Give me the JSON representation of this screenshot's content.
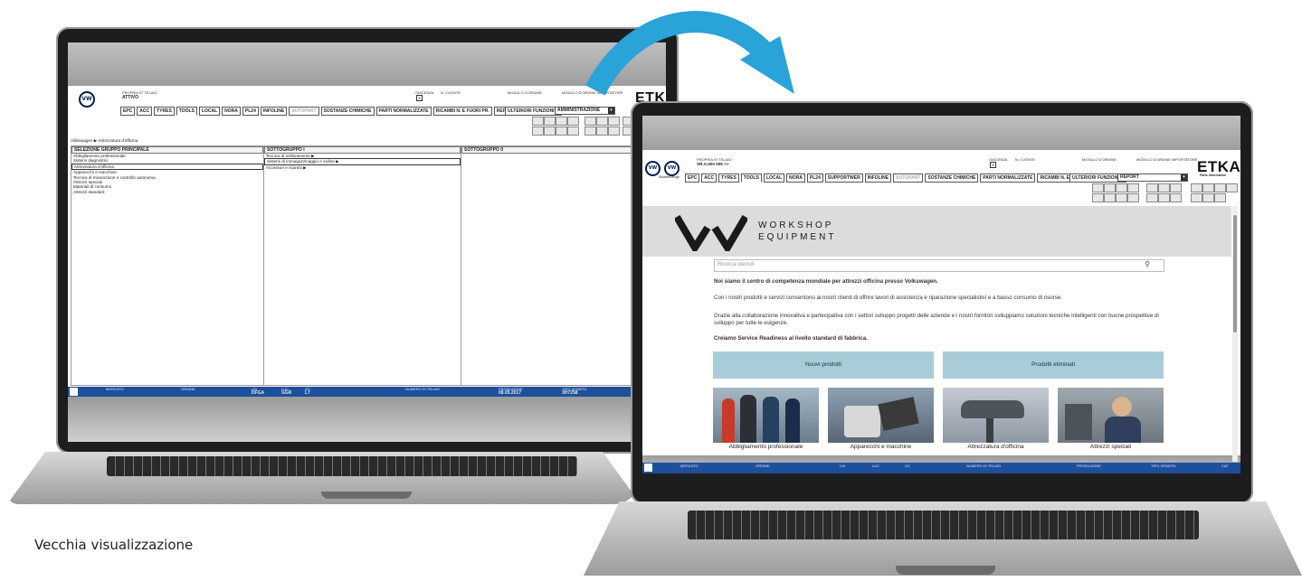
{
  "caption": "Vecchia visualizzazione",
  "brand": {
    "etka": "ETKA",
    "etka_sub": "Parts Information",
    "vw_glyph": "VW",
    "arrow_color": "#29a3d8",
    "statusbar_color": "#1d4f9b"
  },
  "old_ui": {
    "header": {
      "owner_label": "PROPRIA N° TELAIO",
      "owner_value": "ATTIVO",
      "warehouse_label": "GIACENZA",
      "client_label": "N. CLIENTE",
      "order_label": "MODULO D'ORDINE",
      "importer_label": "MODULO D'ORDINE IMPORTATORE"
    },
    "tabs": [
      "EPC",
      "ACC",
      "TYRES",
      "TOOLS",
      "LOCAL",
      "NORA",
      "PL24",
      "INFOLINE",
      "AUTOPART",
      "SOSTANZE CHIMICHE",
      "PARTI NORMALIZZATE",
      "RICAMBI N. E FUORI PR.",
      "REPORT"
    ],
    "more_functions": "ULTERIORI FUNZIONI ▶",
    "dropdown_value": "AMMINISTRAZIONE",
    "breadcrumb": "Volkswagen ▶ Attrezzatura d'officina",
    "columns": [
      {
        "title": "SELEZIONE GRUPPO PRINCIPALE",
        "items": [
          "Abbigliamento professionale",
          "Sistemi diagnostici",
          "Attrezzatura d'officina",
          "Apparecchi e macchine",
          "Tecnica di misurazione e controllo autonoma",
          "Attrezzi speciali",
          "Materiali di consumo",
          "Attrezzi standard"
        ]
      },
      {
        "title": "SOTTOGRUPPO I",
        "items": [
          "Tecnica di sollevamento ▶",
          "Sistemi di immagazzinaggio e ordine ▶",
          "Accessori e ricambi ▶"
        ]
      },
      {
        "title": "SOTTOGRUPPO II",
        "items": []
      }
    ],
    "status": {
      "market_label": "MERCATO",
      "order_label": "ORDINE",
      "lin_label": "LIN",
      "lin_value": "DFGA",
      "luc_label": "LUC",
      "luc_value": "GGR",
      "gc_label": "GC",
      "gc_value": "L7",
      "vin_label": "NUMERO DI TELAIO",
      "production_label": "PRODUZIONE",
      "production_value": "08.05.2017",
      "type_label": "TIPO VENDITA",
      "type_value": "3H7258"
    }
  },
  "new_ui": {
    "header": {
      "owner_label": "PROPRIA N° TELAIO",
      "owner_value": "SR.A.000 005 >>",
      "warehouse_label": "GIACENZA",
      "client_label": "N. CLIENTE",
      "order_label": "MODULO D'ORDINE",
      "importer_label": "MODULO D'ORDINE IMPORTATORE",
      "vw_sub": "Nutzfahrzeuge"
    },
    "tabs": [
      "EPC",
      "ACC",
      "TYRES",
      "TOOLS",
      "LOCAL",
      "NORA",
      "PL24",
      "SUPPORTWER",
      "INFOLINE",
      "AUTOPART",
      "SOSTANZE CHIMICHE",
      "PARTI NORMALIZZATE",
      "RICAMBI N. E FUORI PR."
    ],
    "more_functions": "ULTERIORI FUNZIONI ▶",
    "dropdown_value": "REPORT",
    "banner": {
      "line1": "WORKSHOP",
      "line2": "EQUIPMENT"
    },
    "search_placeholder": "Ricerca utensili",
    "headline": "Noi siamo il centro di competenza mondiale per attrezzi officina presso Volkswagen.",
    "para1": "Con i nostri prodotti e servizi consentono ai nostri clienti di offrire lavori di assistenza e riparazione specialistici e a basso consumo di risorse.",
    "para2": "Grazie alla collaborazione innovativa e partecipativa con i settori sviluppo progetti delle aziende e i nostri fornitori sviluppiamo soluzioni tecniche intelligenti con buone prospettive di sviluppo per tutte le esigenze.",
    "tagline": "Creiamo Service Readiness al livello standard di fabbrica.",
    "buttons": [
      "Nuovi prodotti",
      "Prodotti eliminati"
    ],
    "cards": [
      "Abbigliamento professionale",
      "Apparecchi e macchine",
      "Attrezzatura d'officina",
      "Attrezzi speciali"
    ],
    "status": {
      "market_label": "MERCATO",
      "order_label": "ORDINE",
      "lin_label": "LIN",
      "luc_label": "LUC",
      "gc_label": "GC",
      "vin_label": "NUMERO DI TELAIO",
      "production_label": "PRODUZIONE",
      "type_label": "TIPO VENDITA",
      "cat_label": "CAT"
    }
  }
}
